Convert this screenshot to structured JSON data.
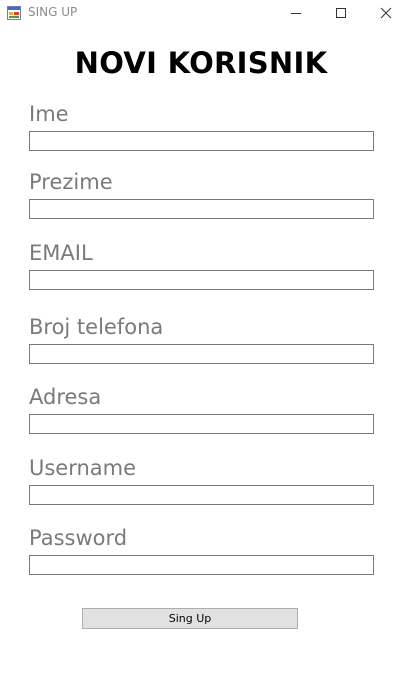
{
  "window": {
    "title": "SING UP"
  },
  "header": {
    "title": "NOVI KORISNIK"
  },
  "form": {
    "fields": [
      {
        "label": "Ime",
        "value": ""
      },
      {
        "label": "Prezime",
        "value": ""
      },
      {
        "label": "EMAIL",
        "value": ""
      },
      {
        "label": "Broj telefona",
        "value": ""
      },
      {
        "label": "Adresa",
        "value": ""
      },
      {
        "label": "Username",
        "value": ""
      },
      {
        "label": "Password",
        "value": ""
      }
    ],
    "submit_label": "Sing Up"
  },
  "icons": {
    "app": "app-form-icon",
    "minimize": "minimize-icon",
    "maximize": "maximize-icon",
    "close": "close-icon"
  },
  "colors": {
    "label": "#7a7a7a",
    "button_bg": "#e1e1e1",
    "button_border": "#adadad",
    "input_border": "#7a7a7a"
  }
}
